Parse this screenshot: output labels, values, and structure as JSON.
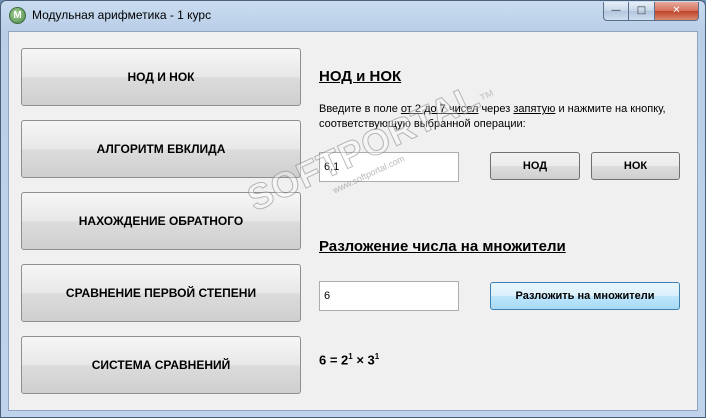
{
  "window": {
    "title": "Модульная арифметика - 1 курс",
    "app_icon_letter": "M",
    "controls": {
      "minimize": "—",
      "maximize": "□",
      "close": "✕"
    }
  },
  "sidebar": {
    "items": [
      {
        "label": "НОД И НОК"
      },
      {
        "label": "АЛГОРИТМ ЕВКЛИДА"
      },
      {
        "label": "НАХОЖДЕНИЕ ОБРАТНОГО"
      },
      {
        "label": "СРАВНЕНИЕ ПЕРВОЙ СТЕПЕНИ"
      },
      {
        "label": "СИСТЕМА СРАВНЕНИЙ"
      }
    ]
  },
  "gcd_lcm": {
    "title": "НОД и НОК",
    "instruction": {
      "part1": "Введите в поле ",
      "part2": "от 2 до 7 чисел",
      "part3": " через ",
      "part4": "запятую",
      "part5": " и нажмите на кнопку, соответствующую выбранной операции:"
    },
    "input_value": "6,1",
    "gcd_button": "НОД",
    "lcm_button": "НОК"
  },
  "factorization": {
    "title": "Разложение числа на множители",
    "input_value": "6",
    "button": "Разложить на множители",
    "result": {
      "prefix": "6 = 2",
      "exp1": "1",
      "middle": " × 3",
      "exp2": "1"
    }
  },
  "watermark": {
    "main": "SOFTPORTAL",
    "tm": "™",
    "sub": "www.softportal.com"
  }
}
